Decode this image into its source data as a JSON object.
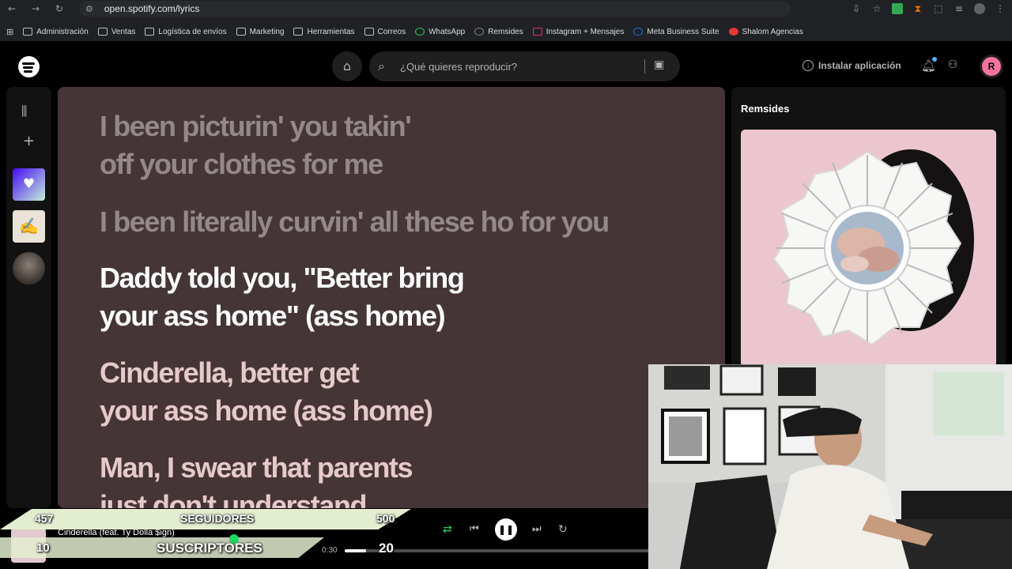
{
  "browser": {
    "url": "open.spotify.com/lyrics",
    "bookmarks": [
      "Administración",
      "Ventas",
      "Logística de envíos",
      "Marketing",
      "Herramientas",
      "Correos",
      "WhatsApp",
      "Remsides",
      "Instagram + Mensajes",
      "Meta Business Suite",
      "Shalom Agencias"
    ]
  },
  "spotify": {
    "search_placeholder": "¿Qué quieres reproducir?",
    "install_label": "Instalar aplicación",
    "avatar_letter": "R",
    "right_panel_title": "Remsides",
    "lyrics": {
      "line1": "I been picturin' you takin'\noff your clothes for me",
      "line2": "I been literally curvin' all these ho for you",
      "line3": "Daddy told you, \"Better bring\nyour ass home\" (ass home)",
      "line4": "Cinderella, better get\nyour ass home (ass home)",
      "line5": "Man, I swear that parents\njust don't understand"
    },
    "player": {
      "now_playing": "Cinderella (feat. Ty Dolla $ign)",
      "current_time": "0:30",
      "progress": 0.07
    }
  },
  "overlay": {
    "followers_current": "457",
    "followers_label": "SEGUIDORES",
    "followers_goal": "500",
    "subs_current": "10",
    "subs_label": "SUSCRIPTORES",
    "subs_goal": "20"
  },
  "colors": {
    "lyrics_bg": "#463537",
    "spotify_green": "#1ed760",
    "overlay_bar": "#e3edcf"
  }
}
